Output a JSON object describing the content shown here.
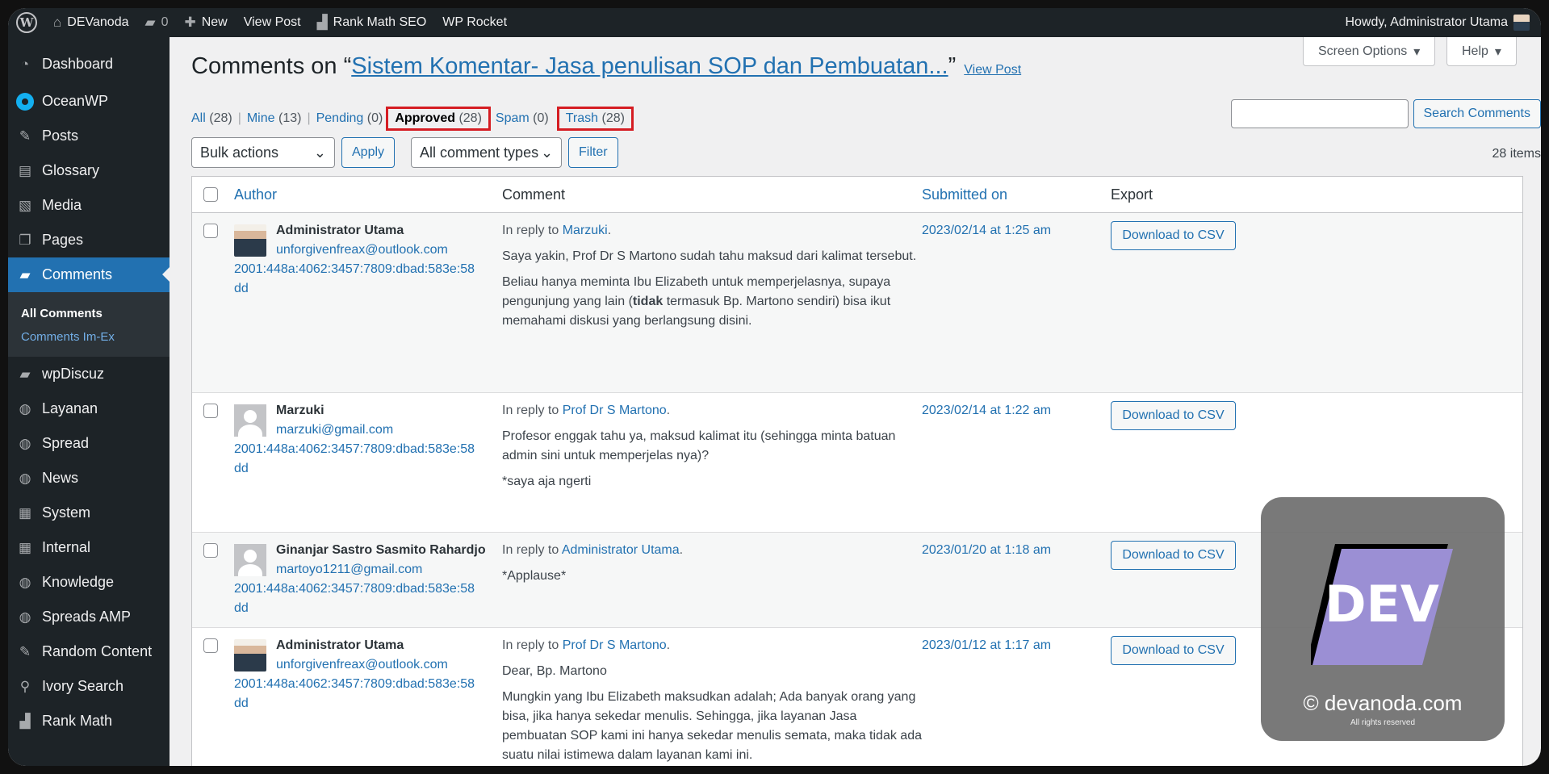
{
  "adminbar": {
    "site_name": "DEVanoda",
    "comments_count": "0",
    "new_label": "New",
    "view_post_label": "View Post",
    "rank_math_label": "Rank Math SEO",
    "wp_rocket_label": "WP Rocket",
    "howdy": "Howdy, Administrator Utama"
  },
  "sidebar": {
    "items": [
      {
        "label": "Dashboard",
        "icon": "dashboard-icon"
      },
      {
        "label": "OceanWP",
        "icon": "oceanwp-icon"
      },
      {
        "label": "Posts",
        "icon": "pin-icon"
      },
      {
        "label": "Glossary",
        "icon": "book-icon"
      },
      {
        "label": "Media",
        "icon": "media-icon"
      },
      {
        "label": "Pages",
        "icon": "pages-icon"
      },
      {
        "label": "Comments",
        "icon": "comment-icon"
      },
      {
        "label": "wpDiscuz",
        "icon": "comment-icon"
      },
      {
        "label": "Layanan",
        "icon": "globe-icon"
      },
      {
        "label": "Spread",
        "icon": "globe-icon"
      },
      {
        "label": "News",
        "icon": "globe-icon"
      },
      {
        "label": "System",
        "icon": "film-icon"
      },
      {
        "label": "Internal",
        "icon": "film-icon"
      },
      {
        "label": "Knowledge",
        "icon": "globe-icon"
      },
      {
        "label": "Spreads AMP",
        "icon": "globe-icon"
      },
      {
        "label": "Random Content",
        "icon": "pin-icon"
      },
      {
        "label": "Ivory Search",
        "icon": "search-icon"
      },
      {
        "label": "Rank Math",
        "icon": "chart-icon"
      }
    ],
    "submenu": [
      "All Comments",
      "Comments Im-Ex"
    ]
  },
  "top_buttons": {
    "screen_options": "Screen Options",
    "help": "Help"
  },
  "page": {
    "title_prefix": "Comments on “",
    "post_title": "Sistem Komentar- Jasa penulisan SOP dan Pembuatan...",
    "title_suffix": "”",
    "view_post": "View Post"
  },
  "filters": [
    {
      "label": "All",
      "count": "(28)"
    },
    {
      "label": "Mine",
      "count": "(13)"
    },
    {
      "label": "Pending",
      "count": "(0)"
    },
    {
      "label": "Approved",
      "count": "(28)"
    },
    {
      "label": "Spam",
      "count": "(0)"
    },
    {
      "label": "Trash",
      "count": "(28)"
    }
  ],
  "search": {
    "button": "Search Comments",
    "value": ""
  },
  "tablenav": {
    "bulk_actions": "Bulk actions",
    "apply": "Apply",
    "comment_types": "All comment types",
    "filter": "Filter",
    "items_count": "28 items"
  },
  "table": {
    "headers": {
      "author": "Author",
      "comment": "Comment",
      "submitted": "Submitted on",
      "export": "Export"
    },
    "export_button": "Download to CSV",
    "rows": [
      {
        "author": "Administrator Utama",
        "email": "unforgivenfreax@outlook.com",
        "ip": "2001:448a:4062:3457:7809:dbad:583e:58dd",
        "reply_prefix": "In reply to",
        "reply_to": "Marzuki",
        "paragraphs": [
          "Saya yakin, Prof Dr S Martono sudah tahu maksud dari kalimat tersebut.",
          "Beliau hanya meminta Ibu Elizabeth untuk memperjelasnya, supaya pengunjung yang lain (",
          "tidak",
          " termasuk Bp. Martono sendiri) bisa ikut memahami diskusi yang berlangsung disini."
        ],
        "date": "2023/02/14 at 1:25 am"
      },
      {
        "author": "Marzuki",
        "email": "marzuki@gmail.com",
        "ip": "2001:448a:4062:3457:7809:dbad:583e:58dd",
        "reply_prefix": "In reply to",
        "reply_to": "Prof Dr S Martono",
        "paragraphs": [
          "Profesor enggak tahu ya, maksud kalimat itu (sehingga minta batuan admin sini untuk memperjelas nya)?",
          "*saya aja ngerti"
        ],
        "date": "2023/02/14 at 1:22 am"
      },
      {
        "author": "Ginanjar Sastro Sasmito Rahardjo",
        "email": "martoyo1211@gmail.com",
        "ip": "2001:448a:4062:3457:7809:dbad:583e:58dd",
        "reply_prefix": "In reply to",
        "reply_to": "Administrator Utama",
        "paragraphs": [
          "*Applause*"
        ],
        "date": "2023/01/20 at 1:18 am"
      },
      {
        "author": "Administrator Utama",
        "email": "unforgivenfreax@outlook.com",
        "ip": "2001:448a:4062:3457:7809:dbad:583e:58dd",
        "reply_prefix": "In reply to",
        "reply_to": "Prof Dr S Martono",
        "paragraphs": [
          "Dear, Bp. Martono",
          "Mungkin yang Ibu Elizabeth maksudkan adalah; Ada banyak orang yang bisa, jika hanya sekedar menulis. Sehingga, jika layanan Jasa pembuatan SOP kami ini hanya sekedar menulis semata, maka tidak ada suatu nilai istimewa dalam layanan kami ini."
        ],
        "date": "2023/01/12 at 1:17 am"
      }
    ]
  },
  "watermark": {
    "logo_text": "DEV",
    "site": "© devanoda.com",
    "rights": "All rights reserved"
  }
}
